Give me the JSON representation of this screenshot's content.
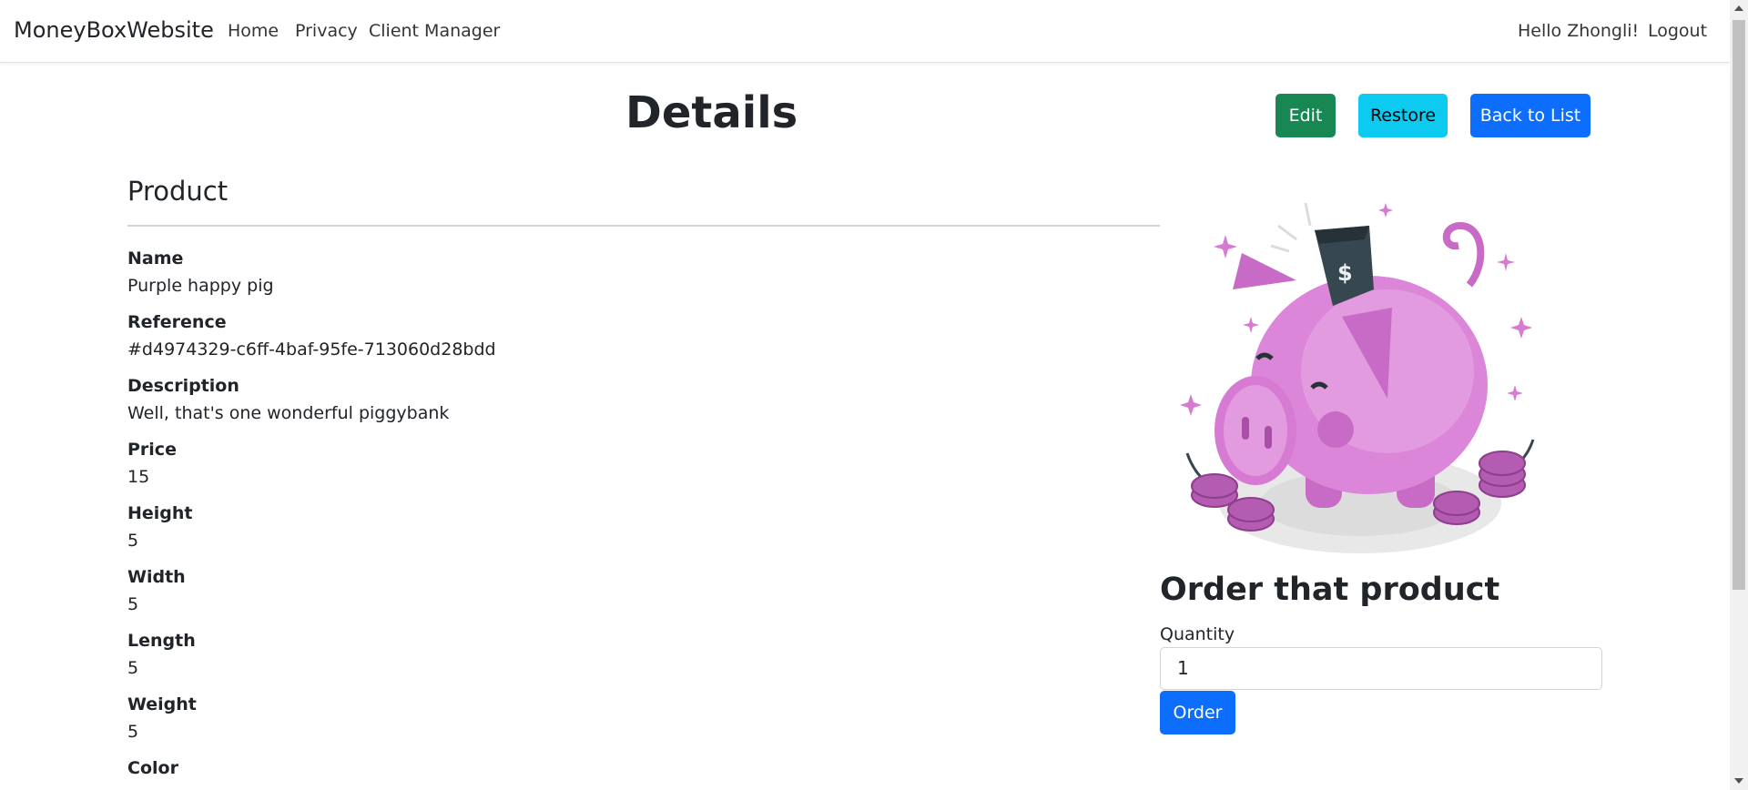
{
  "navbar": {
    "brand": "MoneyBoxWebsite",
    "links": [
      "Home",
      "Privacy",
      "Client Manager"
    ],
    "greeting": "Hello Zhongli!",
    "logout": "Logout"
  },
  "page": {
    "title": "Details",
    "buttons": {
      "edit": "Edit",
      "restore": "Restore",
      "back": "Back to List"
    }
  },
  "product": {
    "section_title": "Product",
    "fields": [
      {
        "label": "Name",
        "value": "Purple happy pig"
      },
      {
        "label": "Reference",
        "value": "#d4974329-c6ff-4baf-95fe-713060d28bdd"
      },
      {
        "label": "Description",
        "value": "Well, that's one wonderful piggybank"
      },
      {
        "label": "Price",
        "value": "15"
      },
      {
        "label": "Height",
        "value": "5"
      },
      {
        "label": "Width",
        "value": "5"
      },
      {
        "label": "Length",
        "value": "5"
      },
      {
        "label": "Weight",
        "value": "5"
      },
      {
        "label": "Color",
        "value": ""
      }
    ],
    "image": "piggy-bank-illustration"
  },
  "order": {
    "title": "Order that product",
    "quantity_label": "Quantity",
    "quantity_value": "1",
    "button": "Order"
  },
  "colors": {
    "success": "#198754",
    "info": "#0dcaf0",
    "primary": "#0d6efd",
    "pig": "#d97fd6"
  }
}
